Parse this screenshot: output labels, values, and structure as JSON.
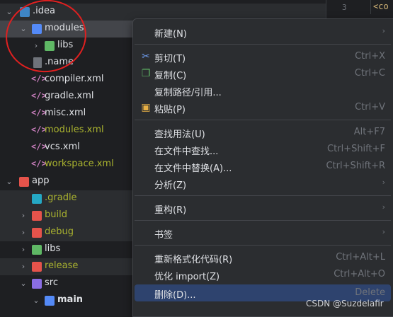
{
  "editor": {
    "line_number": "3",
    "code_text": "<co"
  },
  "tree": {
    "items": [
      {
        "label": "idea_label",
        "text": ".idea"
      },
      {
        "text": "modules"
      },
      {
        "text": "libs"
      },
      {
        "text": ".name"
      },
      {
        "text": "compiler.xml"
      },
      {
        "text": "gradle.xml"
      },
      {
        "text": "misc.xml"
      },
      {
        "text": "modules.xml"
      },
      {
        "text": "vcs.xml"
      },
      {
        "text": "workspace.xml"
      },
      {
        "text": "app"
      },
      {
        "text": ".gradle"
      },
      {
        "text": "build"
      },
      {
        "text": "debug"
      },
      {
        "text": "libs"
      },
      {
        "text": "release"
      },
      {
        "text": "src"
      },
      {
        "text": "main"
      }
    ]
  },
  "menu": {
    "new": {
      "label": "新建(N)"
    },
    "cut": {
      "label": "剪切(T)",
      "shortcut": "Ctrl+X"
    },
    "copy": {
      "label": "复制(C)",
      "shortcut": "Ctrl+C"
    },
    "copy_path": {
      "label": "复制路径/引用..."
    },
    "paste": {
      "label": "粘贴(P)",
      "shortcut": "Ctrl+V"
    },
    "find_usages": {
      "label": "查找用法(U)",
      "shortcut": "Alt+F7"
    },
    "find_in_files": {
      "label": "在文件中查找...",
      "shortcut": "Ctrl+Shift+F"
    },
    "replace_in_files": {
      "label": "在文件中替换(A)...",
      "shortcut": "Ctrl+Shift+R"
    },
    "analyze": {
      "label": "分析(Z)"
    },
    "refactor": {
      "label": "重构(R)"
    },
    "bookmarks": {
      "label": "书签"
    },
    "reformat": {
      "label": "重新格式化代码(R)",
      "shortcut": "Ctrl+Alt+L"
    },
    "optimize_imports": {
      "label": "优化 import(Z)",
      "shortcut": "Ctrl+Alt+O"
    },
    "delete": {
      "label": "删除(D)...",
      "shortcut": "Delete"
    }
  },
  "watermark": "CSDN @Suzdelafir"
}
